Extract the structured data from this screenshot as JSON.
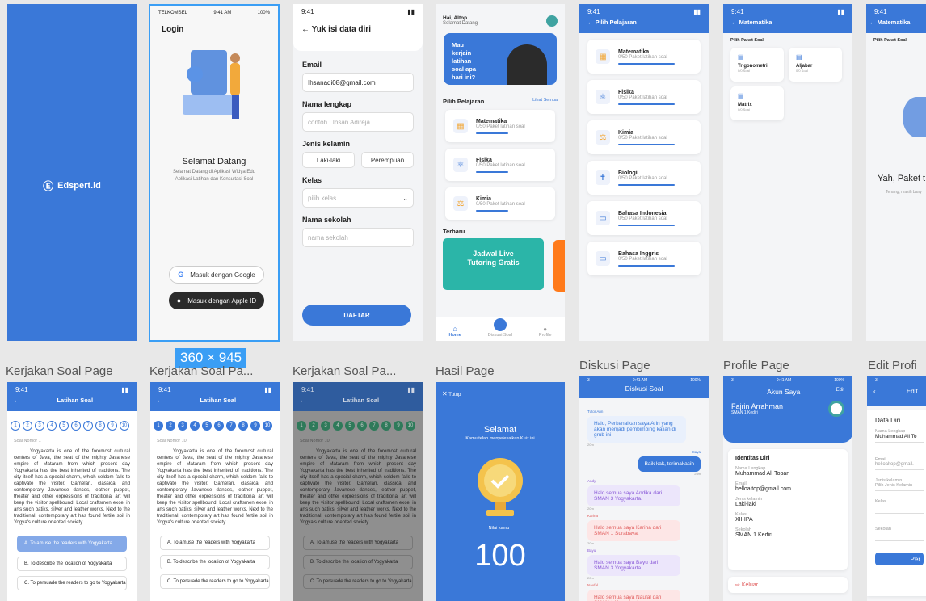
{
  "colors": {
    "primary": "#3a78d8",
    "accent": "#ff7a1a",
    "dark": "#2b2b2b"
  },
  "size_badge": "360 × 945",
  "splash": {
    "brand": "Edspert.id",
    "icon": "edspert-logo-icon"
  },
  "login": {
    "status_carrier": "TELKOMSEL",
    "status_time": "9:41 AM",
    "status_battery": "100%",
    "title": "Login",
    "welcome": "Selamat Datang",
    "desc": "Selamat Datang di Aplikasi Widya Edu Aplikasi Latihan dan Konsultasi Soal",
    "google_button": "Masuk dengan Google",
    "apple_button": "Masuk dengan Apple ID"
  },
  "register": {
    "status_time": "9:41",
    "title": "Yuk isi data diri",
    "email_label": "Email",
    "email_value": "Ihsanadi08@gmail.com",
    "name_label": "Nama lengkap",
    "name_placeholder": "contoh : Ihsan Adireja",
    "gender_label": "Jenis kelamin",
    "male": "Laki-laki",
    "female": "Perempuan",
    "class_label": "Kelas",
    "class_placeholder": "pilih kelas",
    "school_label": "Nama sekolah",
    "school_placeholder": "nama sekolah",
    "submit": "DAFTAR"
  },
  "home": {
    "greeting": "Hai, Altop",
    "subgreeting": "Selamat Datang",
    "banner": "Mau kerjain latihan soal apa hari ini?",
    "section_title": "Pilih Pelajaran",
    "see_all": "Lihat Semua",
    "subjects": [
      {
        "name": "Matematika",
        "sub": "0/50 Paket latihan soal"
      },
      {
        "name": "Fisika",
        "sub": "0/50 Paket latihan soal"
      },
      {
        "name": "Kimia",
        "sub": "0/50 Paket latihan soal"
      }
    ],
    "latest_title": "Terbaru",
    "promo_line1": "Jadwal Live",
    "promo_line2": "Tutoring Gratis",
    "nav": {
      "home": "Home",
      "discussion": "Diskusi Soal",
      "profile": "Profile"
    }
  },
  "subjects_page": {
    "status_time": "9:41",
    "title": "Pilih Pelajaran",
    "items": [
      {
        "name": "Matematika",
        "sub": "0/50 Paket latihan soal"
      },
      {
        "name": "Fisika",
        "sub": "0/50 Paket latihan soal"
      },
      {
        "name": "Kimia",
        "sub": "0/50 Paket latihan soal"
      },
      {
        "name": "Biologi",
        "sub": "0/50 Paket latihan soal"
      },
      {
        "name": "Bahasa Indonesia",
        "sub": "0/50 Paket latihan soal"
      },
      {
        "name": "Bahasa Inggris",
        "sub": "0/50 Paket latihan soal"
      }
    ]
  },
  "packages": {
    "status_time": "9:41",
    "title": "Matematika",
    "subtitle": "Pilih Paket Soal",
    "items": [
      {
        "name": "Trigonometri",
        "sub": "0/0 Soal"
      },
      {
        "name": "Aljabar",
        "sub": "0/0 Soal"
      },
      {
        "name": "Matrix",
        "sub": "0/0 Soal"
      }
    ]
  },
  "empty": {
    "status_time": "9:41",
    "title": "Matematika",
    "subtitle": "Pilih Paket Soal",
    "heading": "Yah, Paket t",
    "desc": "Tenang, masih bany"
  },
  "frame_labels": {
    "quiz1": "Kerjakan Soal Page",
    "quiz2": "Kerjakan Soal Pa...",
    "quiz3": "Kerjakan Soal Pa...",
    "result": "Hasil Page",
    "discussion": "Diskusi Page",
    "profile": "Profile Page",
    "edit": "Edit Profi"
  },
  "quiz": {
    "status_time": "9:41",
    "title": "Latihan Soal",
    "numbers": [
      "1",
      "2",
      "3",
      "4",
      "5",
      "6",
      "7",
      "8",
      "9",
      "10"
    ],
    "question_label": "Soal Nomor 1",
    "question_label_10": "Soal Nomor 10",
    "passage": "Yogyakarta is one of the foremost cultural centers of Java, the seat of the mighty Javanese empire of Mataram from which present day Yogyakarta has the best inherited of traditions. The city itself has a special charm, which seldom fails to captivate the visitor. Gamelan, classical and contemporary Javanese dances, leather puppet, theater and other expressions of traditional art will keep the visitor spellbound. Local craftsmen excel in arts such batiks, silver and leather works. Next to the traditional, contemporary art has found fertile soil in Yogya's culture oriented society.",
    "options": [
      "A. To amuse the readers with Yogyakarta",
      "B. To describe the location of Yogyakarta",
      "C. To persuade the readers to go to Yogyakarta"
    ]
  },
  "result": {
    "close": "Tutup",
    "title": "Selamat",
    "desc": "Kamu telah menyelesaikan Kuiz ini",
    "score_label": "Nilai kamu :",
    "score": "100"
  },
  "discussion": {
    "status_left": "3",
    "status_time": "9:41 AM",
    "status_battery": "100%",
    "title": "Diskusi Soal",
    "messages": [
      {
        "sender": "Tutor Arin",
        "text": "Halo, Perkenalkan saya Arin yang akan menjadi pembimbing kalian di grub ini.",
        "time": "20m",
        "side": "left",
        "color": "#e9f0fc"
      },
      {
        "sender": "Saya",
        "text": "Baik kak, terimakasih",
        "time": "25m",
        "side": "right",
        "color": "#3a78d8"
      },
      {
        "sender": "Andy",
        "text": "Halo semua saya Andika dari SMAN 3 Yogyakarta.",
        "time": "20m",
        "side": "left",
        "color": "#ece6fb"
      },
      {
        "sender": "Karina",
        "text": "Halo semua saya Karina dari SMAN 1 Surabaya.",
        "time": "20m",
        "side": "left",
        "color": "#fde6e6"
      },
      {
        "sender": "Bayu",
        "text": "Halo semua saya Bayu dari SMAN 3 Yogyakarta.",
        "time": "20m",
        "side": "left",
        "color": "#ece6fb"
      },
      {
        "sender": "Naufal",
        "text": "Halo semua saya Naufal dari SMAN 1 Yogyakarta",
        "time": "",
        "side": "left",
        "color": "#fde6e6"
      }
    ]
  },
  "profile": {
    "status_left": "3",
    "status_time": "9:41 AM",
    "status_battery": "100%",
    "title": "Akun Saya",
    "edit": "Edit",
    "name": "Fajrin Arrahman",
    "school": "SMAN 1 Kediri",
    "section": "Identitas Diri",
    "fields": [
      {
        "label": "Nama Lengkap",
        "value": "Muhammad Ali Topan"
      },
      {
        "label": "Email",
        "value": "helloaltop@gmail.com"
      },
      {
        "label": "Jenis kelamin",
        "value": "Laki-laki"
      },
      {
        "label": "Kelas",
        "value": "XII-IPA"
      },
      {
        "label": "Sekolah",
        "value": "SMAN 1 Kediri"
      }
    ],
    "logout": "Keluar"
  },
  "edit": {
    "status_left": "3",
    "title": "Edit",
    "section": "Data Diri",
    "name_label": "Nama Lengkap",
    "name_value": "Muhammad Ali To",
    "email_label": "Email",
    "email_value": "helloaltop@gmail.",
    "gender_label": "Jenis kelamin",
    "gender_value": "Pilih Jenis Kelamin",
    "class_label": "Kelas",
    "school_label": "Sekolah",
    "submit": "Per"
  }
}
